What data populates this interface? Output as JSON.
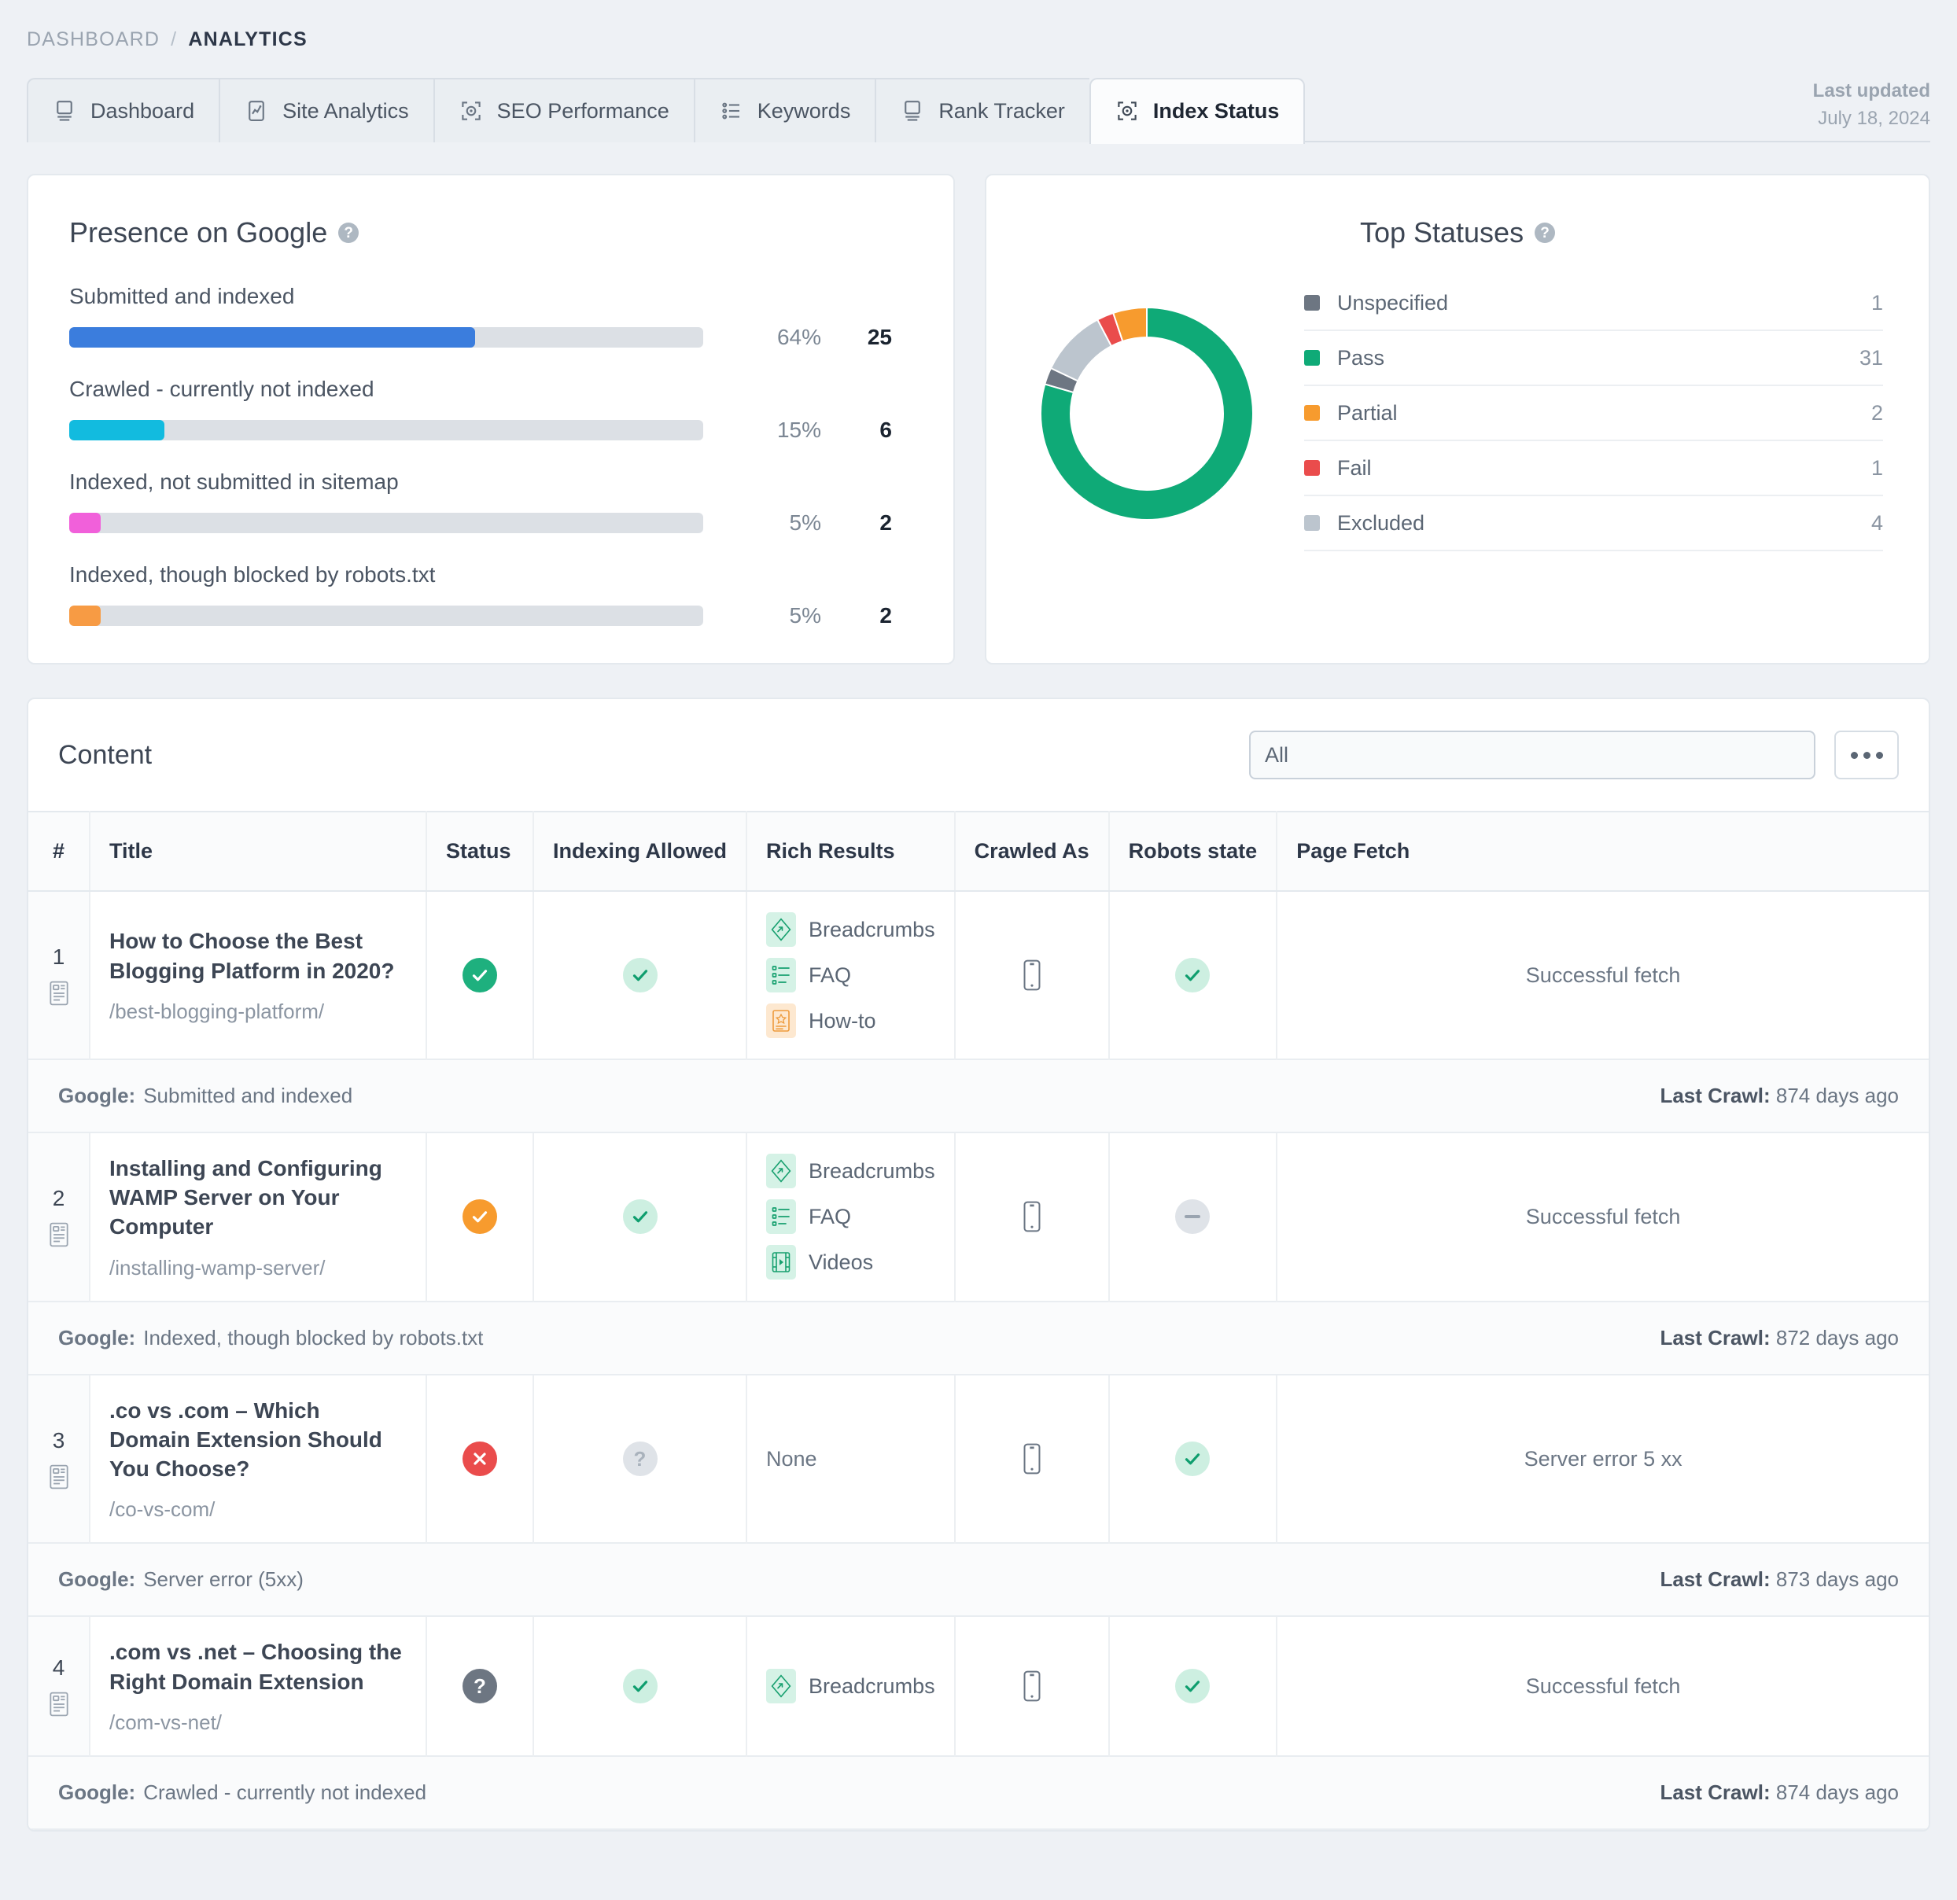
{
  "breadcrumb": {
    "root": "DASHBOARD",
    "separator": "/",
    "current": "ANALYTICS"
  },
  "tabs": [
    {
      "label": "Dashboard",
      "icon": "monitor-icon",
      "active": false
    },
    {
      "label": "Site Analytics",
      "icon": "chart-icon",
      "active": false
    },
    {
      "label": "SEO Performance",
      "icon": "target-icon",
      "active": false
    },
    {
      "label": "Keywords",
      "icon": "list-icon",
      "active": false
    },
    {
      "label": "Rank Tracker",
      "icon": "monitor-icon",
      "active": false
    },
    {
      "label": "Index Status",
      "icon": "target-icon",
      "active": true
    }
  ],
  "last_updated": {
    "label": "Last updated",
    "date": "July 18, 2024"
  },
  "presence": {
    "title": "Presence on Google",
    "help_icon": "help-circle-icon",
    "rows": [
      {
        "label": "Submitted and indexed",
        "percent": "64%",
        "pct_value": 64,
        "count": "25",
        "color": "#3b7ddd"
      },
      {
        "label": "Crawled - currently not indexed",
        "percent": "15%",
        "pct_value": 15,
        "count": "6",
        "color": "#12bbdf"
      },
      {
        "label": "Indexed, not submitted in sitemap",
        "percent": "5%",
        "pct_value": 5,
        "count": "2",
        "color": "#f160da"
      },
      {
        "label": "Indexed, though blocked by robots.txt",
        "percent": "5%",
        "pct_value": 5,
        "count": "2",
        "color": "#f79b44"
      }
    ]
  },
  "statuses": {
    "title": "Top Statuses",
    "help_icon": "help-circle-icon"
  },
  "chart_data": {
    "type": "pie",
    "title": "Top Statuses",
    "legend_position": "right",
    "labels": [
      "Unspecified",
      "Pass",
      "Partial",
      "Fail",
      "Excluded"
    ],
    "values": [
      1,
      31,
      2,
      1,
      4
    ],
    "colors": [
      "#6d7682",
      "#0faa77",
      "#f79b2e",
      "#ea4c4c",
      "#bcc5ce"
    ],
    "draw_order": [
      "Pass",
      "Unspecified",
      "Excluded",
      "Fail",
      "Partial"
    ],
    "total": 39,
    "donut": true
  },
  "content": {
    "title": "Content",
    "filter_value": "All",
    "filter_placeholder": "All",
    "more_button": "more-options-button",
    "columns": [
      "#",
      "Title",
      "Status",
      "Indexing Allowed",
      "Rich Results",
      "Crawled As",
      "Robots state",
      "Page Fetch"
    ],
    "rows": [
      {
        "num": "1",
        "title": "How to Choose the Best Blogging Platform in 2020?",
        "url": "/best-blogging-platform/",
        "status": "pass",
        "indexing_allowed": "yes",
        "rich_results": [
          {
            "label": "Breadcrumbs",
            "icon": "breadcrumbs-icon",
            "tone": "green"
          },
          {
            "label": "FAQ",
            "icon": "faq-icon",
            "tone": "green"
          },
          {
            "label": "How-to",
            "icon": "how-to-icon",
            "tone": "orange"
          }
        ],
        "crawled_as": "mobile-icon",
        "robots_state": "yes",
        "page_fetch": "Successful fetch",
        "google_label": "Google:",
        "google_value": "Submitted and indexed",
        "last_crawl_label": "Last Crawl:",
        "last_crawl_value": "874 days ago"
      },
      {
        "num": "2",
        "title": "Installing and Configuring WAMP Server on Your Computer",
        "url": "/installing-wamp-server/",
        "status": "partial",
        "indexing_allowed": "yes",
        "rich_results": [
          {
            "label": "Breadcrumbs",
            "icon": "breadcrumbs-icon",
            "tone": "green"
          },
          {
            "label": "FAQ",
            "icon": "faq-icon",
            "tone": "green"
          },
          {
            "label": "Videos",
            "icon": "videos-icon",
            "tone": "green"
          }
        ],
        "crawled_as": "mobile-icon",
        "robots_state": "dash",
        "page_fetch": "Successful fetch",
        "google_label": "Google:",
        "google_value": "Indexed, though blocked by robots.txt",
        "last_crawl_label": "Last Crawl:",
        "last_crawl_value": "872 days ago"
      },
      {
        "num": "3",
        "title": ".co vs .com – Which Domain Extension Should You Choose?",
        "url": "/co-vs-com/",
        "status": "fail",
        "indexing_allowed": "unknown",
        "rich_results": [],
        "rich_results_none": "None",
        "crawled_as": "mobile-icon",
        "robots_state": "yes",
        "page_fetch": "Server error 5 xx",
        "google_label": "Google:",
        "google_value": "Server error (5xx)",
        "last_crawl_label": "Last Crawl:",
        "last_crawl_value": "873 days ago"
      },
      {
        "num": "4",
        "title": ".com vs .net – Choosing the Right Domain Extension",
        "url": "/com-vs-net/",
        "status": "unknown",
        "indexing_allowed": "yes",
        "rich_results": [
          {
            "label": "Breadcrumbs",
            "icon": "breadcrumbs-icon",
            "tone": "green"
          }
        ],
        "crawled_as": "mobile-icon",
        "robots_state": "yes",
        "page_fetch": "Successful fetch",
        "google_label": "Google:",
        "google_value": "Crawled - currently not indexed",
        "last_crawl_label": "Last Crawl:",
        "last_crawl_value": "874 days ago"
      }
    ]
  }
}
